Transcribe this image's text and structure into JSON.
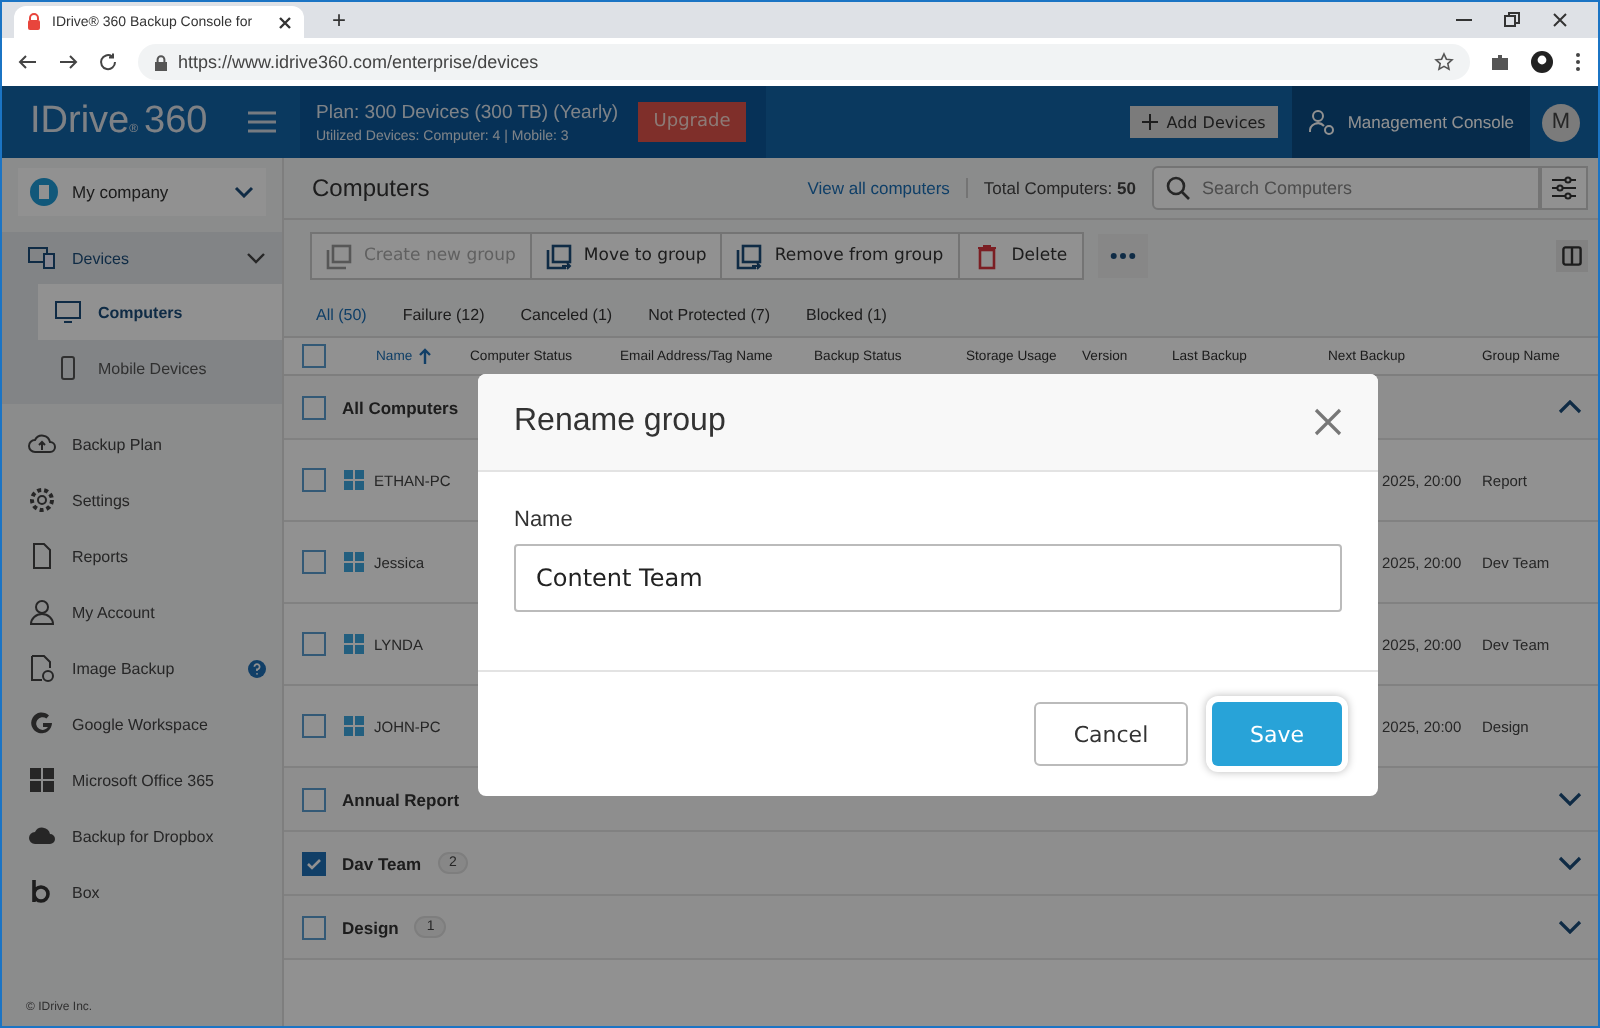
{
  "browser": {
    "tab_title": "IDrive® 360 Backup Console for",
    "new_tab": "+",
    "url": "https://www.idrive360.com/enterprise/devices"
  },
  "header": {
    "logo": "IDrive",
    "logo_mark": "®",
    "logo_suffix": "360",
    "plan": "Plan: 300 Devices (300 TB) (Yearly)",
    "usage": "Utilized Devices: Computer: 4 |  Mobile: 3",
    "upgrade": "Upgrade",
    "add_devices": "Add Devices",
    "console": "Management Console",
    "avatar": "M"
  },
  "sidebar": {
    "company": "My company",
    "items": [
      {
        "label": "Devices",
        "selected": false,
        "expanded": true,
        "help": false,
        "children": [
          {
            "label": "Computers",
            "selected": true
          },
          {
            "label": "Mobile Devices",
            "selected": false
          }
        ]
      },
      {
        "label": "Backup Plan",
        "selected": false,
        "help": false
      },
      {
        "label": "Settings",
        "selected": false,
        "help": false
      },
      {
        "label": "Reports",
        "selected": false,
        "help": false
      },
      {
        "label": "My Account",
        "selected": false,
        "help": false
      },
      {
        "label": "Image Backup",
        "selected": false,
        "help": true
      },
      {
        "label": "Google Workspace",
        "selected": false,
        "help": false
      },
      {
        "label": "Microsoft Office 365",
        "selected": false,
        "help": false
      },
      {
        "label": "Backup for Dropbox",
        "selected": false,
        "help": false
      },
      {
        "label": "Box",
        "selected": false,
        "help": false
      }
    ],
    "footer": "© IDrive Inc."
  },
  "main": {
    "title": "Computers",
    "view_all": "View all computers",
    "total": "Total Computers: **50**",
    "search": {
      "placeholder": "Search Computers"
    },
    "header_checked": false,
    "toolbar": [
      {
        "label": "Create new group",
        "disabled": true
      },
      {
        "label": "Move to group",
        "disabled": false
      },
      {
        "label": "Remove from group",
        "disabled": false
      },
      {
        "label": "Delete",
        "disabled": false
      }
    ],
    "filters": [
      {
        "label": "All (50)",
        "selected": true
      },
      {
        "label": "Failure (12)",
        "selected": false
      },
      {
        "label": "Canceled (1)",
        "selected": false
      },
      {
        "label": "Not Protected (7)",
        "selected": false
      },
      {
        "label": "Blocked (1)",
        "selected": false
      }
    ],
    "columns": [
      {
        "label": "Name",
        "sorted": true
      },
      {
        "label": "Computer Status",
        "sorted": false
      },
      {
        "label": "Email Address/Tag Name",
        "sorted": false
      },
      {
        "label": "Backup Status",
        "sorted": false
      },
      {
        "label": "Storage Usage",
        "sorted": false
      },
      {
        "label": "Version",
        "sorted": false
      },
      {
        "label": "Last Backup",
        "sorted": false
      },
      {
        "label": "Next Backup",
        "sorted": false
      },
      {
        "label": "Group Name",
        "sorted": false
      }
    ],
    "groups": [
      {
        "name": "All Computers",
        "checked": false,
        "expanded": true,
        "rows": [
          {
            "name": "ETHAN-PC",
            "checked": false,
            "next_backup": "2025, 20:00",
            "group": "Report"
          },
          {
            "name": "Jessica",
            "checked": false,
            "next_backup": "2025, 20:00",
            "group": "Dev Team"
          },
          {
            "name": "LYNDA",
            "checked": false,
            "next_backup": "2025, 20:00",
            "group": "Dev Team"
          },
          {
            "name": "JOHN-PC",
            "checked": false,
            "next_backup": "2025, 20:00",
            "group": "Design"
          }
        ]
      },
      {
        "name": "Annual Report",
        "checked": false,
        "expanded": false
      },
      {
        "name": "Dav Team",
        "count": "2",
        "checked": true,
        "expanded": false
      },
      {
        "name": "Design",
        "count": "1",
        "checked": false,
        "expanded": false
      }
    ]
  },
  "dialog": {
    "title": "Rename group",
    "label": "Name",
    "value": "Content Team",
    "cancel": "Cancel",
    "save": "Save"
  }
}
